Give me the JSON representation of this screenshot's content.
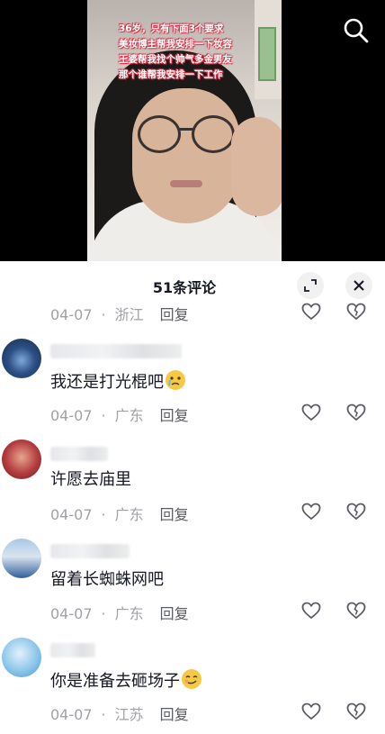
{
  "video": {
    "caption_lines": [
      "36岁，只有下面3个要求",
      "美妆博主帮我安排一下妆容",
      "王婆帮我找个帅气多金男友",
      "那个谁帮我安排一下工作"
    ]
  },
  "top_bar": {
    "search_icon": "search-icon"
  },
  "comments_panel": {
    "title": "51条评论",
    "expand_icon": "expand-icon",
    "close_icon": "close-icon",
    "first_meta": {
      "date": "04-07",
      "location": "浙江",
      "reply": "回复"
    },
    "comments": [
      {
        "text": "我还是打光棍吧",
        "emoji": "crying-face-emoji",
        "date": "04-07",
        "location": "广东",
        "reply": "回复"
      },
      {
        "text": "许愿去庙里",
        "date": "04-07",
        "location": "广东",
        "reply": "回复"
      },
      {
        "text": "留着长蜘蛛网吧",
        "date": "04-07",
        "location": "广东",
        "reply": "回复"
      },
      {
        "text": "你是准备去砸场子",
        "emoji": "smirk-face-emoji",
        "date": "04-07",
        "location": "江苏",
        "reply": "回复"
      }
    ]
  },
  "colors": {
    "text_primary": "#161823",
    "text_secondary": "#a1a2a6",
    "caption_outline": "#d83a4c"
  }
}
